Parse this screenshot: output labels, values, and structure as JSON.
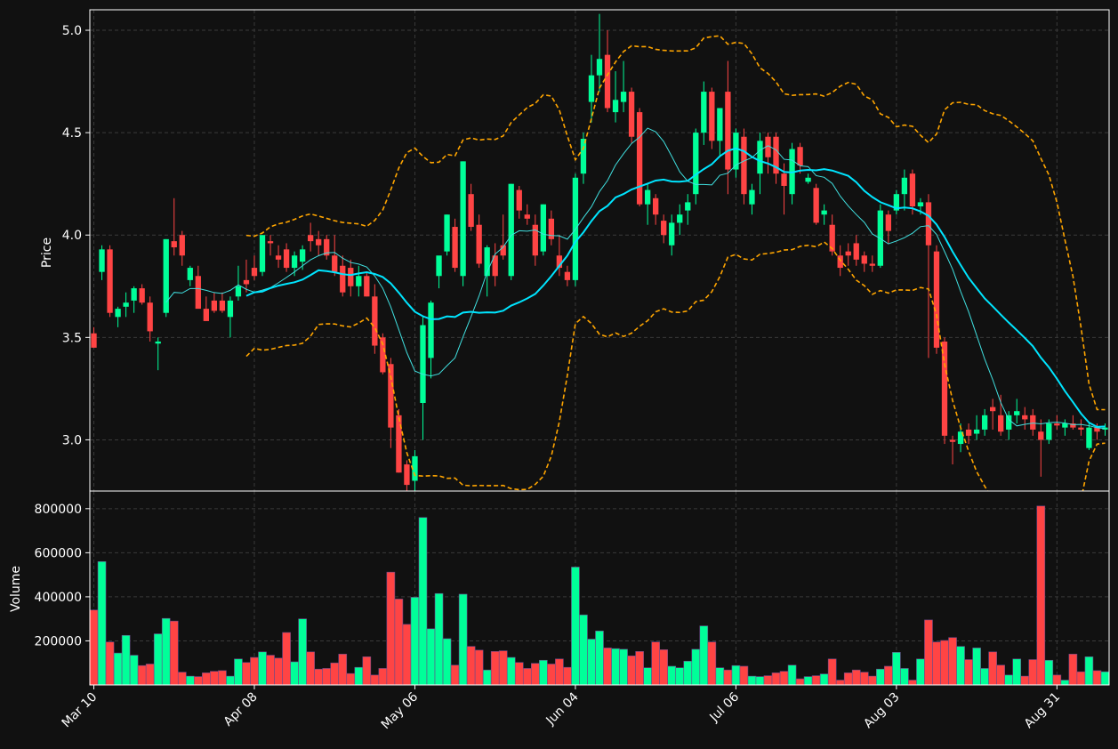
{
  "chart_data": {
    "type": "candlestick",
    "colors": {
      "background": "#111111",
      "up": "#00ff99",
      "down": "#ff4444",
      "ma_short": "#40e0e0",
      "ma_long": "#00e5ff",
      "bollinger": "#ffa500",
      "grid": "#3a3a3a",
      "axes": "#ffffff"
    },
    "price_panel": {
      "ylabel": "Price",
      "ylim": [
        2.75,
        5.1
      ],
      "yticks": [
        "3.0",
        "3.5",
        "4.0",
        "4.5",
        "5.0"
      ],
      "ytick_values": [
        3.0,
        3.5,
        4.0,
        4.5,
        5.0
      ],
      "grid": true
    },
    "volume_panel": {
      "ylabel": "Volume",
      "ylim": [
        0,
        880000
      ],
      "yticks": [
        "200000",
        "400000",
        "600000",
        "800000"
      ],
      "ytick_values": [
        200000,
        400000,
        600000,
        800000
      ],
      "grid": true
    },
    "xaxis": {
      "tick_labels": [
        "Mar 10",
        "Apr 08",
        "May 06",
        "Jun 04",
        "Jul 06",
        "Aug 03",
        "Aug 31"
      ],
      "tick_index": [
        0,
        20,
        40,
        60,
        80,
        100,
        120
      ],
      "n_bars": 127
    },
    "candles": [
      [
        3.52,
        3.55,
        3.45,
        3.45,
        340000
      ],
      [
        3.82,
        3.95,
        3.78,
        3.93,
        560000
      ],
      [
        3.93,
        3.95,
        3.6,
        3.62,
        195000
      ],
      [
        3.6,
        3.65,
        3.55,
        3.64,
        145000
      ],
      [
        3.65,
        3.72,
        3.6,
        3.67,
        225000
      ],
      [
        3.68,
        3.75,
        3.62,
        3.74,
        135000
      ],
      [
        3.74,
        3.76,
        3.66,
        3.67,
        88000
      ],
      [
        3.67,
        3.7,
        3.48,
        3.53,
        95000
      ],
      [
        3.47,
        3.5,
        3.34,
        3.48,
        232000
      ],
      [
        3.62,
        3.98,
        3.6,
        3.98,
        302000
      ],
      [
        3.97,
        4.18,
        3.9,
        3.94,
        290000
      ],
      [
        4.0,
        4.02,
        3.85,
        3.9,
        58000
      ],
      [
        3.78,
        3.85,
        3.75,
        3.84,
        40000
      ],
      [
        3.8,
        3.85,
        3.68,
        3.64,
        38000
      ],
      [
        3.64,
        3.7,
        3.58,
        3.58,
        55000
      ],
      [
        3.68,
        3.72,
        3.62,
        3.63,
        62000
      ],
      [
        3.68,
        3.72,
        3.62,
        3.63,
        65000
      ],
      [
        3.6,
        3.7,
        3.5,
        3.68,
        40000
      ],
      [
        3.7,
        3.85,
        3.68,
        3.75,
        118000
      ],
      [
        3.78,
        3.88,
        3.72,
        3.76,
        102000
      ],
      [
        3.84,
        3.9,
        3.78,
        3.8,
        125000
      ],
      [
        3.82,
        4.0,
        3.8,
        4.0,
        150000
      ],
      [
        3.97,
        4.0,
        3.9,
        3.96,
        135000
      ],
      [
        3.9,
        3.95,
        3.84,
        3.88,
        122000
      ],
      [
        3.93,
        3.96,
        3.82,
        3.84,
        238000
      ],
      [
        3.84,
        3.92,
        3.8,
        3.9,
        105000
      ],
      [
        3.87,
        3.95,
        3.83,
        3.93,
        300000
      ],
      [
        4.0,
        4.06,
        3.92,
        3.97,
        150000
      ],
      [
        3.98,
        4.02,
        3.9,
        3.95,
        72000
      ],
      [
        3.98,
        4.0,
        3.88,
        3.9,
        75000
      ],
      [
        3.9,
        4.0,
        3.8,
        3.82,
        100000
      ],
      [
        3.85,
        3.9,
        3.7,
        3.72,
        140000
      ],
      [
        3.84,
        3.88,
        3.7,
        3.75,
        52000
      ],
      [
        3.75,
        3.85,
        3.7,
        3.8,
        80000
      ],
      [
        3.8,
        3.82,
        3.7,
        3.7,
        128000
      ],
      [
        3.7,
        3.76,
        3.42,
        3.46,
        45000
      ],
      [
        3.5,
        3.52,
        3.32,
        3.33,
        75000
      ],
      [
        3.37,
        3.4,
        2.96,
        3.06,
        512000
      ],
      [
        3.12,
        3.15,
        2.84,
        2.84,
        390000
      ],
      [
        2.88,
        2.9,
        2.75,
        2.78,
        275000
      ],
      [
        2.8,
        2.95,
        2.72,
        2.92,
        398000
      ],
      [
        3.18,
        3.6,
        3.0,
        3.56,
        760000
      ],
      [
        3.4,
        3.68,
        3.3,
        3.67,
        255000
      ],
      [
        3.8,
        3.85,
        3.74,
        3.9,
        415000
      ],
      [
        3.92,
        4.1,
        3.9,
        4.1,
        210000
      ],
      [
        4.04,
        4.08,
        3.82,
        3.84,
        90000
      ],
      [
        3.8,
        4.36,
        3.75,
        4.36,
        412000
      ],
      [
        4.2,
        4.25,
        4.02,
        4.04,
        175000
      ],
      [
        4.05,
        4.1,
        3.84,
        3.86,
        158000
      ],
      [
        3.8,
        3.95,
        3.7,
        3.94,
        68000
      ],
      [
        3.9,
        3.96,
        3.75,
        3.8,
        152000
      ],
      [
        3.95,
        4.1,
        3.88,
        3.9,
        155000
      ],
      [
        3.8,
        4.25,
        3.78,
        4.25,
        125000
      ],
      [
        4.22,
        4.24,
        4.08,
        4.12,
        102000
      ],
      [
        4.1,
        4.15,
        4.05,
        4.08,
        75000
      ],
      [
        4.05,
        4.1,
        3.85,
        3.9,
        98000
      ],
      [
        3.92,
        4.15,
        3.9,
        4.15,
        112000
      ],
      [
        4.08,
        4.12,
        3.95,
        3.98,
        95000
      ],
      [
        3.9,
        4.0,
        3.8,
        3.84,
        118000
      ],
      [
        3.82,
        3.85,
        3.75,
        3.78,
        80000
      ],
      [
        3.78,
        4.3,
        3.75,
        4.28,
        535000
      ],
      [
        4.3,
        4.5,
        4.25,
        4.47,
        318000
      ],
      [
        4.65,
        4.88,
        4.55,
        4.78,
        208000
      ],
      [
        4.78,
        5.08,
        4.7,
        4.86,
        245000
      ],
      [
        4.88,
        5.0,
        4.6,
        4.62,
        168000
      ],
      [
        4.6,
        4.8,
        4.55,
        4.66,
        165000
      ],
      [
        4.65,
        4.85,
        4.6,
        4.7,
        162000
      ],
      [
        4.7,
        4.72,
        4.45,
        4.48,
        132000
      ],
      [
        4.6,
        4.62,
        4.14,
        4.15,
        152000
      ],
      [
        4.15,
        4.25,
        4.05,
        4.22,
        78000
      ],
      [
        4.18,
        4.2,
        4.05,
        4.1,
        195000
      ],
      [
        4.07,
        4.1,
        3.96,
        4.0,
        160000
      ],
      [
        3.95,
        4.1,
        3.9,
        4.06,
        85000
      ],
      [
        4.06,
        4.15,
        4.0,
        4.1,
        78000
      ],
      [
        4.12,
        4.2,
        4.05,
        4.16,
        108000
      ],
      [
        4.2,
        4.52,
        4.15,
        4.5,
        162000
      ],
      [
        4.5,
        4.75,
        4.44,
        4.7,
        268000
      ],
      [
        4.7,
        4.72,
        4.42,
        4.46,
        195000
      ],
      [
        4.46,
        4.62,
        4.38,
        4.62,
        78000
      ],
      [
        4.7,
        4.85,
        4.2,
        4.32,
        68000
      ],
      [
        4.32,
        4.52,
        4.28,
        4.5,
        88000
      ],
      [
        4.48,
        4.52,
        4.15,
        4.2,
        85000
      ],
      [
        4.15,
        4.25,
        4.1,
        4.22,
        40000
      ],
      [
        4.3,
        4.5,
        4.2,
        4.46,
        38000
      ],
      [
        4.48,
        4.5,
        4.3,
        4.38,
        42000
      ],
      [
        4.48,
        4.5,
        4.25,
        4.3,
        55000
      ],
      [
        4.3,
        4.35,
        4.1,
        4.24,
        62000
      ],
      [
        4.2,
        4.45,
        4.15,
        4.42,
        90000
      ],
      [
        4.43,
        4.45,
        4.3,
        4.34,
        28000
      ],
      [
        4.26,
        4.3,
        4.25,
        4.28,
        38000
      ],
      [
        4.23,
        4.25,
        4.05,
        4.06,
        42000
      ],
      [
        4.1,
        4.15,
        4.05,
        4.12,
        50000
      ],
      [
        4.05,
        4.1,
        3.9,
        3.92,
        118000
      ],
      [
        3.9,
        3.95,
        3.8,
        3.84,
        22000
      ],
      [
        3.92,
        3.96,
        3.85,
        3.9,
        55000
      ],
      [
        3.96,
        4.0,
        3.85,
        3.88,
        68000
      ],
      [
        3.9,
        3.92,
        3.82,
        3.86,
        58000
      ],
      [
        3.86,
        3.9,
        3.82,
        3.85,
        40000
      ],
      [
        3.85,
        4.15,
        3.84,
        4.12,
        72000
      ],
      [
        4.1,
        4.12,
        3.96,
        4.02,
        85000
      ],
      [
        4.12,
        4.22,
        4.1,
        4.2,
        148000
      ],
      [
        4.2,
        4.32,
        4.12,
        4.28,
        75000
      ],
      [
        4.3,
        4.32,
        4.1,
        4.14,
        22000
      ],
      [
        4.14,
        4.18,
        4.1,
        4.16,
        118000
      ],
      [
        4.16,
        4.2,
        3.4,
        3.95,
        295000
      ],
      [
        3.92,
        3.95,
        3.42,
        3.45,
        195000
      ],
      [
        3.48,
        3.5,
        2.98,
        3.02,
        202000
      ],
      [
        3.0,
        3.02,
        2.88,
        2.99,
        215000
      ],
      [
        2.98,
        3.08,
        2.94,
        3.04,
        175000
      ],
      [
        3.05,
        3.08,
        2.98,
        3.02,
        115000
      ],
      [
        3.03,
        3.12,
        3.0,
        3.05,
        168000
      ],
      [
        3.05,
        3.15,
        3.02,
        3.12,
        75000
      ],
      [
        3.16,
        3.2,
        3.05,
        3.14,
        150000
      ],
      [
        3.12,
        3.22,
        3.02,
        3.04,
        90000
      ],
      [
        3.05,
        3.14,
        3.0,
        3.12,
        45000
      ],
      [
        3.12,
        3.2,
        3.08,
        3.14,
        118000
      ],
      [
        3.12,
        3.16,
        3.05,
        3.1,
        40000
      ],
      [
        3.12,
        3.15,
        3.02,
        3.05,
        115000
      ],
      [
        3.04,
        3.1,
        2.82,
        3.0,
        812000
      ],
      [
        3.0,
        3.1,
        2.98,
        3.08,
        112000
      ],
      [
        3.08,
        3.12,
        3.05,
        3.07,
        45000
      ],
      [
        3.06,
        3.1,
        3.02,
        3.08,
        22000
      ],
      [
        3.08,
        3.12,
        3.05,
        3.06,
        140000
      ],
      [
        3.06,
        3.1,
        3.02,
        3.05,
        60000
      ],
      [
        2.96,
        3.08,
        2.95,
        3.06,
        128000
      ],
      [
        3.06,
        3.08,
        3.0,
        3.04,
        65000
      ],
      [
        3.05,
        3.08,
        3.02,
        3.06,
        60000
      ]
    ]
  }
}
